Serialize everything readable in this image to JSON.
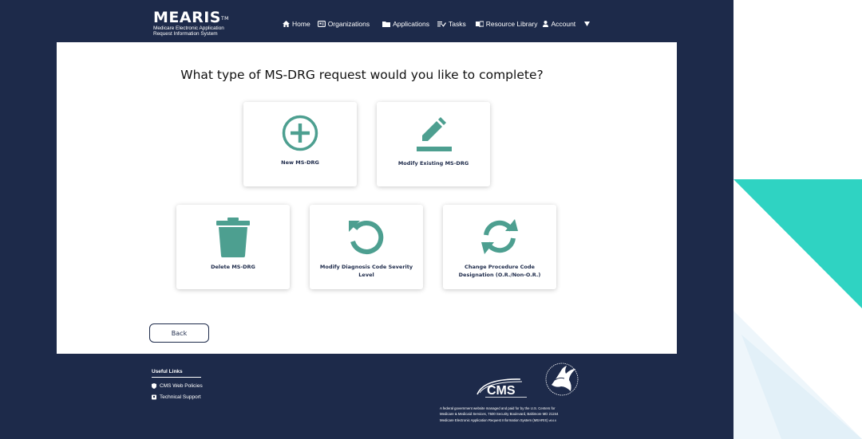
{
  "header": {
    "logo_text": "MEARIS",
    "logo_trademark": "TM",
    "logo_subtitle": "Medicare Electronic Application Request Information System",
    "nav": [
      {
        "label": "Home",
        "icon": "home-icon"
      },
      {
        "label": "Organizations",
        "icon": "organization-icon"
      },
      {
        "label": "Applications",
        "icon": "folder-icon"
      },
      {
        "label": "Tasks",
        "icon": "tasks-icon"
      },
      {
        "label": "Resource Library",
        "icon": "book-icon"
      },
      {
        "label": "Account",
        "icon": "user-icon",
        "dropdown": "chevron-down-icon"
      }
    ]
  },
  "main": {
    "title": "What type of MS-DRG request would you like to complete?",
    "options": [
      {
        "label": "New MS-DRG",
        "icon": "plus-circle-icon"
      },
      {
        "label": "Modify Existing MS-DRG",
        "icon": "pencil-icon"
      },
      {
        "label": "Delete MS-DRG",
        "icon": "trash-icon"
      },
      {
        "label": "Modify Diagnosis Code Severity Level",
        "icon": "rotate-icon"
      },
      {
        "label": "Change Procedure Code Designation (O.R./Non-O.R.)",
        "icon": "refresh-icon"
      }
    ],
    "back_label": "Back"
  },
  "footer": {
    "useful_links_title": "Useful Links",
    "links": [
      {
        "label": "CMS Web Policies",
        "icon": "shield-icon"
      },
      {
        "label": "Technical Support",
        "icon": "support-icon"
      }
    ],
    "cms_logo_text": "CMS",
    "notice_line1": "A federal government website managed and paid for by the U.S. Centers for",
    "notice_line2": "Medicare & Medicaid Services, 7500 Security Boulevard, Baltimore MD 21244",
    "notice_line3": "Medicare Electronic Application Request Information System (MEARIS)",
    "notice_version": "v8.6.6"
  },
  "colors": {
    "navy": "#1d2a4a",
    "teal": "#4d9f90",
    "accent_triangle": "#2fd3c2"
  }
}
